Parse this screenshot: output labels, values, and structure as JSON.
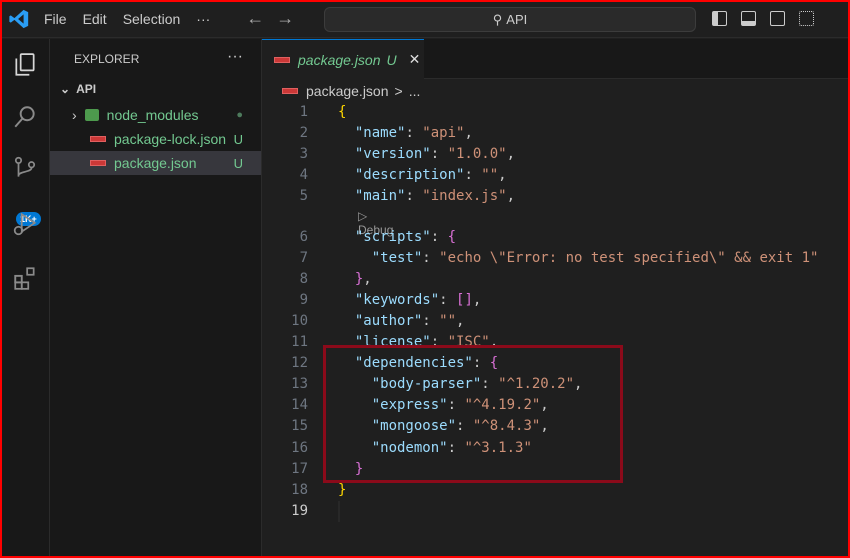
{
  "titlebar": {
    "menus": [
      "File",
      "Edit",
      "Selection",
      "···"
    ],
    "search": "API"
  },
  "activity": {
    "scm_badge": "1K+"
  },
  "sidebar": {
    "title": "EXPLORER",
    "more": "···",
    "root": "API",
    "items": [
      {
        "label": "node_modules",
        "status": "●"
      },
      {
        "label": "package-lock.json",
        "status": "U"
      },
      {
        "label": "package.json",
        "status": "U"
      }
    ]
  },
  "tab": {
    "label": "package.json",
    "status": "U",
    "close": "✕"
  },
  "breadcrumb": {
    "file": "package.json",
    "sep": ">",
    "rest": "..."
  },
  "codelens": "Debug",
  "lines": [
    [
      [
        "b1",
        "{"
      ]
    ],
    [
      [
        "k",
        "  \"name\""
      ],
      [
        "p",
        ": "
      ],
      [
        "s",
        "\"api\""
      ],
      [
        "p",
        ","
      ]
    ],
    [
      [
        "k",
        "  \"version\""
      ],
      [
        "p",
        ": "
      ],
      [
        "s",
        "\"1.0.0\""
      ],
      [
        "p",
        ","
      ]
    ],
    [
      [
        "k",
        "  \"description\""
      ],
      [
        "p",
        ": "
      ],
      [
        "s",
        "\"\""
      ],
      [
        "p",
        ","
      ]
    ],
    [
      [
        "k",
        "  \"main\""
      ],
      [
        "p",
        ": "
      ],
      [
        "s",
        "\"index.js\""
      ],
      [
        "p",
        ","
      ]
    ],
    [
      [
        "k",
        "  \"scripts\""
      ],
      [
        "p",
        ": "
      ],
      [
        "b2",
        "{"
      ]
    ],
    [
      [
        "k",
        "    \"test\""
      ],
      [
        "p",
        ": "
      ],
      [
        "s",
        "\"echo \\\"Error: no test specified\\\" && exit 1\""
      ]
    ],
    [
      [
        "b2",
        "  }"
      ],
      [
        "p",
        ","
      ]
    ],
    [
      [
        "k",
        "  \"keywords\""
      ],
      [
        "p",
        ": "
      ],
      [
        "b2",
        "[]"
      ],
      [
        "p",
        ","
      ]
    ],
    [
      [
        "k",
        "  \"author\""
      ],
      [
        "p",
        ": "
      ],
      [
        "s",
        "\"\""
      ],
      [
        "p",
        ","
      ]
    ],
    [
      [
        "k",
        "  \"license\""
      ],
      [
        "p",
        ": "
      ],
      [
        "s",
        "\"ISC\""
      ],
      [
        "p",
        ","
      ]
    ],
    [
      [
        "k",
        "  \"dependencies\""
      ],
      [
        "p",
        ": "
      ],
      [
        "b2",
        "{"
      ]
    ],
    [
      [
        "k",
        "    \"body-parser\""
      ],
      [
        "p",
        ": "
      ],
      [
        "s",
        "\"^1.20.2\""
      ],
      [
        "p",
        ","
      ]
    ],
    [
      [
        "k",
        "    \"express\""
      ],
      [
        "p",
        ": "
      ],
      [
        "s",
        "\"^4.19.2\""
      ],
      [
        "p",
        ","
      ]
    ],
    [
      [
        "k",
        "    \"mongoose\""
      ],
      [
        "p",
        ": "
      ],
      [
        "s",
        "\"^8.4.3\""
      ],
      [
        "p",
        ","
      ]
    ],
    [
      [
        "k",
        "    \"nodemon\""
      ],
      [
        "p",
        ": "
      ],
      [
        "s",
        "\"^3.1.3\""
      ]
    ],
    [
      [
        "b2",
        "  }"
      ]
    ],
    [
      [
        "b1",
        "}"
      ]
    ],
    []
  ]
}
